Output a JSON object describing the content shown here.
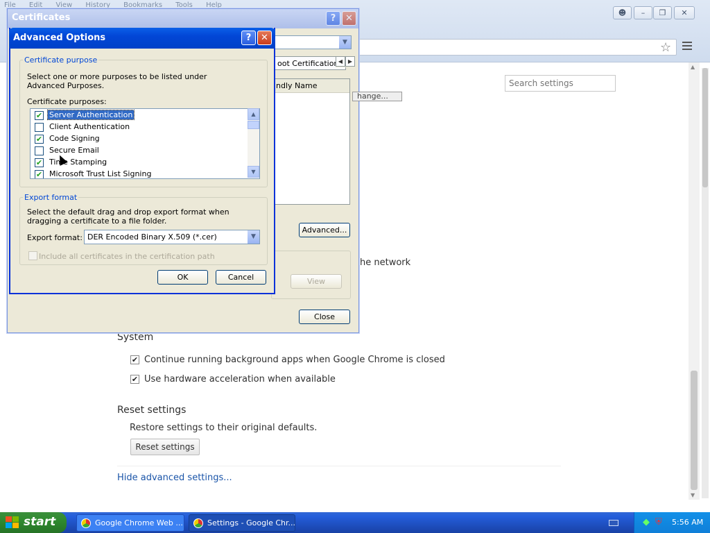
{
  "browser": {
    "menu": [
      "File",
      "Edit",
      "View",
      "History",
      "Bookmarks",
      "Tools",
      "Help"
    ],
    "search_placeholder": "Search settings",
    "network_text_fragment": "he network",
    "system": {
      "heading": "System",
      "options": [
        {
          "label": "Continue running background apps when Google Chrome is closed",
          "checked": true
        },
        {
          "label": "Use hardware acceleration when available",
          "checked": true
        }
      ]
    },
    "reset": {
      "heading": "Reset settings",
      "description": "Restore settings to their original defaults.",
      "button": "Reset settings"
    },
    "hide_advanced_link": "Hide advanced settings..."
  },
  "certificates_dialog": {
    "title": "Certificates",
    "tab_fragment": "oot Certification",
    "list_header_fragment": "ndly Name",
    "change_fragment": "hange...",
    "advanced_button": "Advanced...",
    "view_button": "View",
    "close_button": "Close"
  },
  "advanced_options": {
    "title": "Advanced Options",
    "purpose_group": "Certificate purpose",
    "purpose_description": "Select one or more purposes to be listed under Advanced Purposes.",
    "purposes_label": "Certificate purposes:",
    "purposes": [
      {
        "label": "Server Authentication",
        "checked": true,
        "selected": true
      },
      {
        "label": "Client Authentication",
        "checked": false,
        "selected": false
      },
      {
        "label": "Code Signing",
        "checked": true,
        "selected": false
      },
      {
        "label": "Secure Email",
        "checked": false,
        "selected": false
      },
      {
        "label": "Time Stamping",
        "checked": true,
        "selected": false
      },
      {
        "label": "Microsoft Trust List Signing",
        "checked": true,
        "selected": false
      }
    ],
    "export_group": "Export format",
    "export_description": "Select the default drag and drop export format when dragging a certificate to a file folder.",
    "export_label": "Export format:",
    "export_value": "DER Encoded Binary X.509 (*.cer)",
    "include_all_label": "Include all certificates in the certification path",
    "ok_button": "OK",
    "cancel_button": "Cancel"
  },
  "taskbar": {
    "start_label": "start",
    "tasks": [
      {
        "label": "Google Chrome Web ...",
        "active": false
      },
      {
        "label": "Settings - Google Chr...",
        "active": true
      }
    ],
    "clock": "5:56 AM"
  },
  "colors": {
    "xp_title_blue": "#0a5fe8",
    "link_blue": "#1a54a8",
    "selection_blue": "#316ac5",
    "check_green": "#21a121",
    "start_green": "#2f8a2f"
  }
}
